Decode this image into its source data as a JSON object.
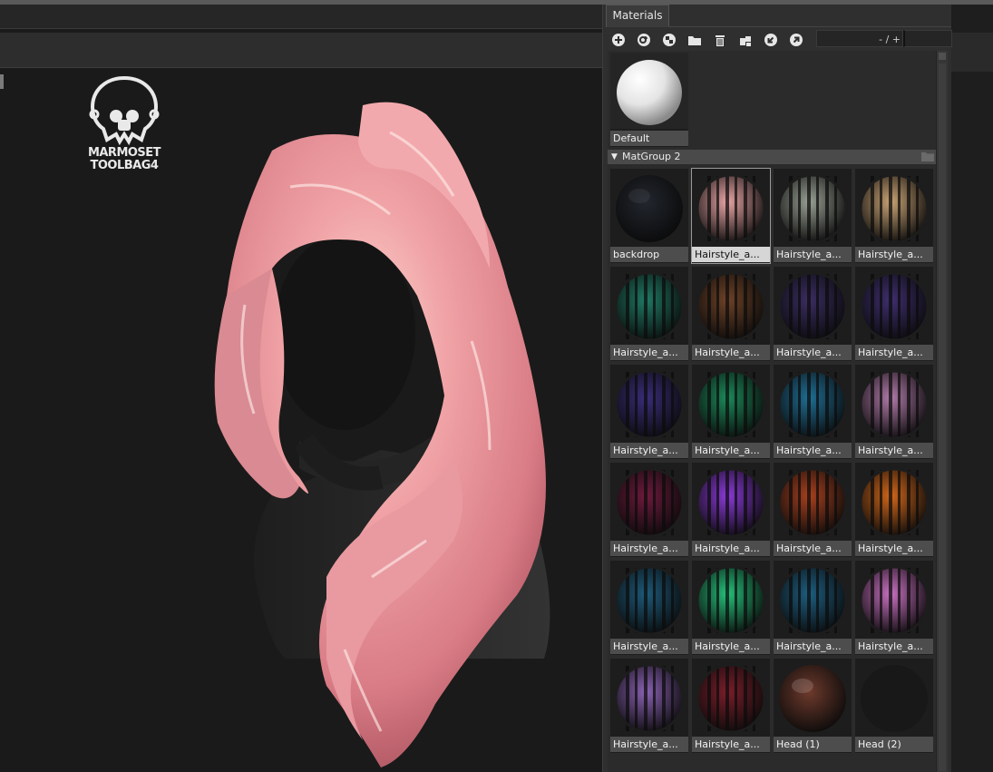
{
  "panel": {
    "tab_label": "Materials",
    "zoom_text": "- / +"
  },
  "toolbar": {
    "icons": [
      "add-material-icon",
      "duplicate-material-icon",
      "checker-icon",
      "folder-icon",
      "trash-icon",
      "apply-to-selection-icon",
      "import-icon",
      "export-icon"
    ]
  },
  "logo": {
    "line1": "MARMOSET",
    "line2": "TOOLBAG4"
  },
  "default_material": {
    "label": "Default"
  },
  "group": {
    "name": "MatGroup 2"
  },
  "materials": [
    {
      "label": "backdrop",
      "color": "#22262e",
      "style": "solid"
    },
    {
      "label": "Hairstyle_a...",
      "color": "#e7a4a4",
      "style": "hair",
      "selected": true
    },
    {
      "label": "Hairstyle_a...",
      "color": "#98a093",
      "style": "hair"
    },
    {
      "label": "Hairstyle_a...",
      "color": "#c8a274",
      "style": "hair"
    },
    {
      "label": "Hairstyle_a...",
      "color": "#1f7a64",
      "style": "hair"
    },
    {
      "label": "Hairstyle_a...",
      "color": "#6e4227",
      "style": "hair"
    },
    {
      "label": "Hairstyle_a...",
      "color": "#3a2d62",
      "style": "hair"
    },
    {
      "label": "Hairstyle_a...",
      "color": "#3e2e6e",
      "style": "hair"
    },
    {
      "label": "Hairstyle_a...",
      "color": "#3a2d7a",
      "style": "hair"
    },
    {
      "label": "Hairstyle_a...",
      "color": "#1b8a5a",
      "style": "hair"
    },
    {
      "label": "Hairstyle_a...",
      "color": "#1f6e94",
      "style": "hair"
    },
    {
      "label": "Hairstyle_a...",
      "color": "#b07aa8",
      "style": "hair"
    },
    {
      "label": "Hairstyle_a...",
      "color": "#6e1a3c",
      "style": "hair"
    },
    {
      "label": "Hairstyle_a...",
      "color": "#8a3ad8",
      "style": "hair"
    },
    {
      "label": "Hairstyle_a...",
      "color": "#a8401e",
      "style": "hair"
    },
    {
      "label": "Hairstyle_a...",
      "color": "#d0661a",
      "style": "hair"
    },
    {
      "label": "Hairstyle_a...",
      "color": "#1d5a7a",
      "style": "hair"
    },
    {
      "label": "Hairstyle_a...",
      "color": "#25c07a",
      "style": "hair"
    },
    {
      "label": "Hairstyle_a...",
      "color": "#1d5e80",
      "style": "hair"
    },
    {
      "label": "Hairstyle_a...",
      "color": "#c870c0",
      "style": "hair"
    },
    {
      "label": "Hairstyle_a...",
      "color": "#8a62b4",
      "style": "hair"
    },
    {
      "label": "Hairstyle_a...",
      "color": "#7a1e2a",
      "style": "hair"
    },
    {
      "label": "Head (1)",
      "color": "#6e3a2c",
      "style": "skin"
    },
    {
      "label": "Head (2)",
      "color": "#1e1e1e",
      "style": "dark"
    }
  ]
}
